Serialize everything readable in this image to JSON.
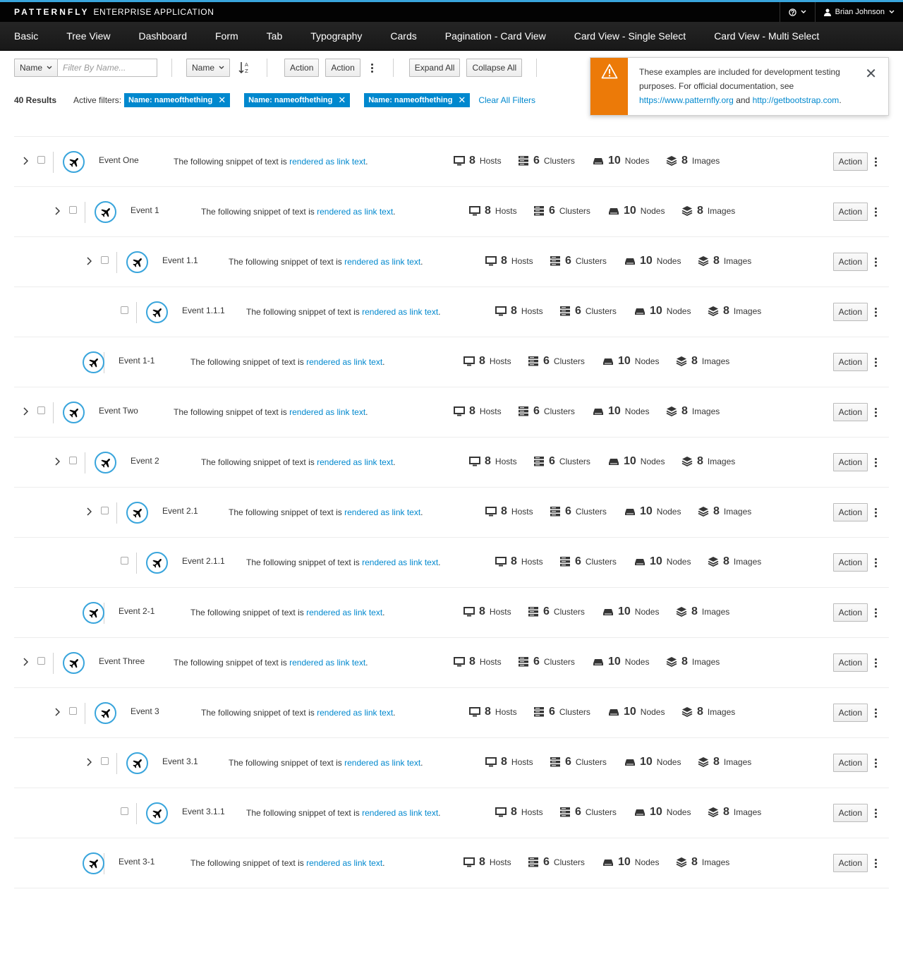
{
  "masthead": {
    "brand_strong": "PATTERNFLY",
    "brand_light": "ENTERPRISE APPLICATION",
    "user": "Brian Johnson"
  },
  "nav": [
    "Basic",
    "Tree View",
    "Dashboard",
    "Form",
    "Tab",
    "Typography",
    "Cards",
    "Pagination - Card View",
    "Card View - Single Select",
    "Card View - Multi Select"
  ],
  "toolbar": {
    "filter_field": "Name",
    "filter_placeholder": "Filter By Name...",
    "sort_field": "Name",
    "action1": "Action",
    "action2": "Action",
    "expand_all": "Expand All",
    "collapse_all": "Collapse All"
  },
  "results": {
    "count": "40 Results",
    "active_filters_label": "Active filters:",
    "filters": [
      "Name: nameofthething",
      "Name: nameofthething",
      "Name: nameofthething"
    ],
    "clear_all": "Clear All Filters"
  },
  "toast": {
    "text_before": "These examples are included for development testing purposes. For official documentation, see",
    "link1": "https://www.patternfly.org",
    "and": "and",
    "link2": "http://getbootstrap.com",
    "period": "."
  },
  "row_text": {
    "desc_prefix": "The following snippet of text is",
    "desc_link": "rendered as link text",
    "desc_suffix": ".",
    "hosts_num": "8",
    "hosts_label": "Hosts",
    "clusters_num": "6",
    "clusters_label": "Clusters",
    "nodes_num": "10",
    "nodes_label": "Nodes",
    "images_num": "8",
    "images_label": "Images",
    "action": "Action"
  },
  "rows": [
    {
      "name": "Event One",
      "level": 0,
      "expandable": true
    },
    {
      "name": "Event 1",
      "level": 1,
      "expandable": true
    },
    {
      "name": "Event 1.1",
      "level": 2,
      "expandable": true
    },
    {
      "name": "Event 1.1.1",
      "level": 3,
      "expandable": false
    },
    {
      "name": "Event 1-1",
      "level": 1,
      "expandable": false
    },
    {
      "name": "Event Two",
      "level": 0,
      "expandable": true
    },
    {
      "name": "Event 2",
      "level": 1,
      "expandable": true
    },
    {
      "name": "Event 2.1",
      "level": 2,
      "expandable": true
    },
    {
      "name": "Event 2.1.1",
      "level": 3,
      "expandable": false
    },
    {
      "name": "Event 2-1",
      "level": 1,
      "expandable": false
    },
    {
      "name": "Event Three",
      "level": 0,
      "expandable": true
    },
    {
      "name": "Event 3",
      "level": 1,
      "expandable": true
    },
    {
      "name": "Event 3.1",
      "level": 2,
      "expandable": true
    },
    {
      "name": "Event 3.1.1",
      "level": 3,
      "expandable": false
    },
    {
      "name": "Event 3-1",
      "level": 1,
      "expandable": false
    }
  ]
}
